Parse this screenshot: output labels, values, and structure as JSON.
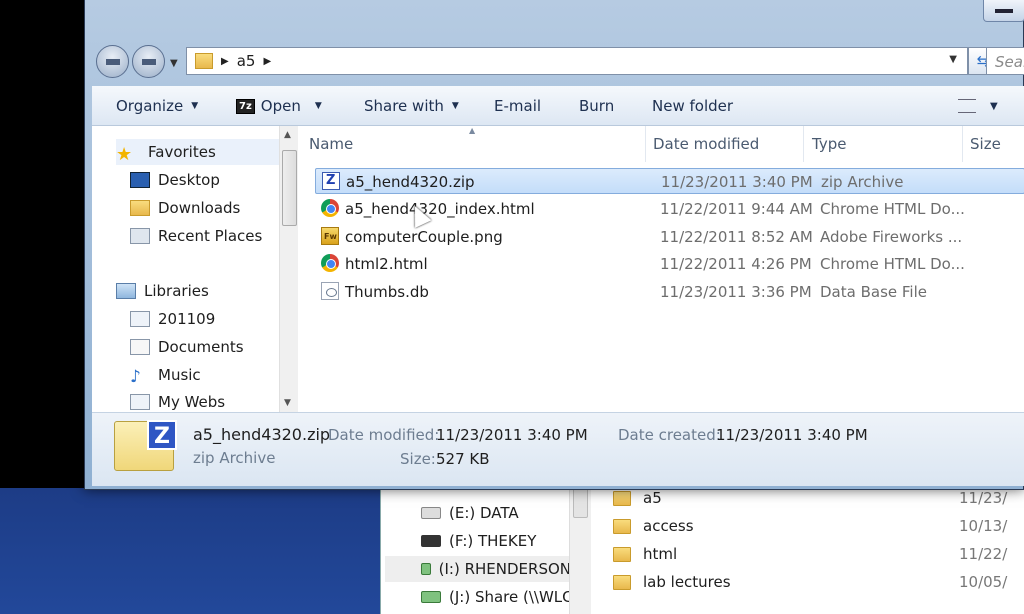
{
  "address": {
    "path": "a5"
  },
  "search": {
    "placeholder": "Sear"
  },
  "toolbar": {
    "organize": "Organize",
    "sevenzip_badge": "7z",
    "open": "Open",
    "share_with": "Share with",
    "email": "E-mail",
    "burn": "Burn",
    "new_folder": "New folder"
  },
  "nav": {
    "favorites": "Favorites",
    "desktop": "Desktop",
    "downloads": "Downloads",
    "recent_places": "Recent Places",
    "libraries": "Libraries",
    "lib_201109": "201109",
    "documents": "Documents",
    "music": "Music",
    "my_webs": "My Webs"
  },
  "columns": {
    "name": "Name",
    "date_modified": "Date modified",
    "type": "Type",
    "size": "Size"
  },
  "files": [
    {
      "name": "a5_hend4320.zip",
      "date": "11/23/2011 3:40 PM",
      "type": "zip Archive",
      "icon": "zip-icon"
    },
    {
      "name": "a5_hend4320_index.html",
      "date": "11/22/2011 9:44 AM",
      "type": "Chrome HTML Do...",
      "icon": "chrome-icon"
    },
    {
      "name": "computerCouple.png",
      "date": "11/22/2011 8:52 AM",
      "type": "Adobe Fireworks ...",
      "icon": "fireworks-icon"
    },
    {
      "name": "html2.html",
      "date": "11/22/2011 4:26 PM",
      "type": "Chrome HTML Do...",
      "icon": "chrome-icon"
    },
    {
      "name": "Thumbs.db",
      "date": "11/23/2011 3:36 PM",
      "type": "Data Base File",
      "icon": "database-icon"
    }
  ],
  "details": {
    "filename": "a5_hend4320.zip",
    "filetype": "zip Archive",
    "date_modified_label": "Date modified:",
    "date_modified": "11/23/2011 3:40 PM",
    "date_created_label": "Date created:",
    "date_created": "11/23/2011 3:40 PM",
    "size_label": "Size:",
    "size": "527 KB"
  },
  "background_window": {
    "nav": [
      "(E:) DATA",
      "(F:) THEKEY",
      "(I:) RHENDERSON",
      "(J:) Share (\\\\WLC"
    ],
    "folders": [
      {
        "name": "a5",
        "date": "11/23/"
      },
      {
        "name": "access",
        "date": "10/13/"
      },
      {
        "name": "html",
        "date": "11/22/"
      },
      {
        "name": "lab lectures",
        "date": "10/05/"
      }
    ]
  }
}
